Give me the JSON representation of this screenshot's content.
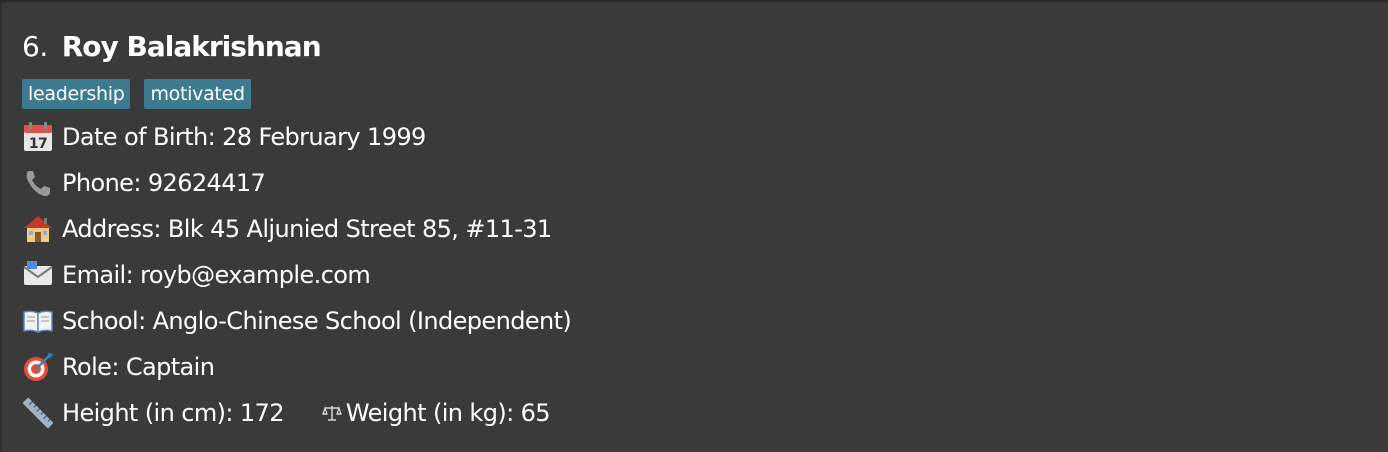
{
  "person": {
    "index": "6.",
    "name": "Roy Balakrishnan",
    "tags": [
      "leadership",
      "motivated"
    ],
    "dob_label": "Date of Birth: 28 February 1999",
    "phone_label": "Phone: 92624417",
    "address_label": "Address: Blk 45 Aljunied Street 85, #11-31",
    "email_label": "Email: royb@example.com",
    "school_label": "School: Anglo-Chinese School (Independent)",
    "role_label": "Role: Captain",
    "height_label": "Height (in cm): 172",
    "weight_label": "Weight (in kg): 65"
  },
  "icons": {
    "dob": "calendar-icon",
    "phone": "telephone-icon",
    "address": "house-icon",
    "email": "envelope-icon",
    "school": "book-icon",
    "role": "target-icon",
    "height": "ruler-icon",
    "weight": "scale-icon"
  },
  "colors": {
    "card_background": "#3a3a3a",
    "tag_background": "#3e7b91",
    "text": "#ffffff"
  }
}
